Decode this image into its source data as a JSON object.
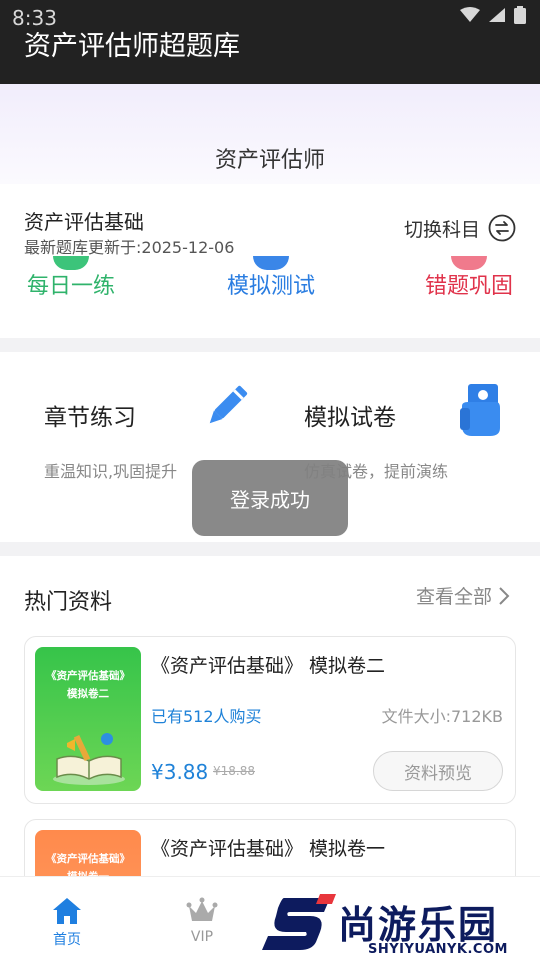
{
  "status_bar": {
    "time": "8:33"
  },
  "app": {
    "title": "资产评估师超题库"
  },
  "hero": {
    "title": "资产评估师"
  },
  "subject": {
    "name": "资产评估基础",
    "update_text": "最新题库更新于:2025-12-06",
    "switch_label": "切换科目"
  },
  "modes": {
    "daily": "每日一练",
    "mock_test": "模拟测试",
    "wrong_review": "错题巩固"
  },
  "practice": {
    "chapter": {
      "title": "章节练习",
      "desc": "重温知识,巩固提升",
      "icon": "pencil-icon"
    },
    "mock_paper": {
      "title": "模拟试卷",
      "desc": "仿真试卷，提前演练",
      "icon": "hand-holding-paper-icon"
    }
  },
  "toast": {
    "text": "登录成功"
  },
  "hot_resources": {
    "title": "热门资料",
    "view_all": "查看全部",
    "items": [
      {
        "name": "《资产评估基础》 模拟卷二",
        "cover_title_line1": "《资产评估基础》",
        "cover_title_line2": "模拟卷二",
        "buyers": "已有512人购买",
        "size": "文件大小:712KB",
        "price": "¥3.88",
        "original_price": "¥18.88",
        "preview": "资料预览",
        "cover_color": "#3cc74c"
      },
      {
        "name": "《资产评估基础》 模拟卷一",
        "cover_title_line1": "《资产评估基础》",
        "cover_title_line2": "模拟卷一",
        "cover_color": "#ff8a4c"
      }
    ]
  },
  "bottom_nav": {
    "items": [
      {
        "label": "首页",
        "icon": "home-icon",
        "active": true
      },
      {
        "label": "VIP",
        "icon": "crown-icon",
        "active": false
      }
    ]
  },
  "watermark": {
    "cn": "尚游乐园",
    "en": "SHYIYUANYK.COM"
  },
  "colors": {
    "accent_blue": "#1f82d8",
    "daily_green": "#2fb36b",
    "wrong_red": "#e0334b",
    "header_bg": "#222222"
  }
}
